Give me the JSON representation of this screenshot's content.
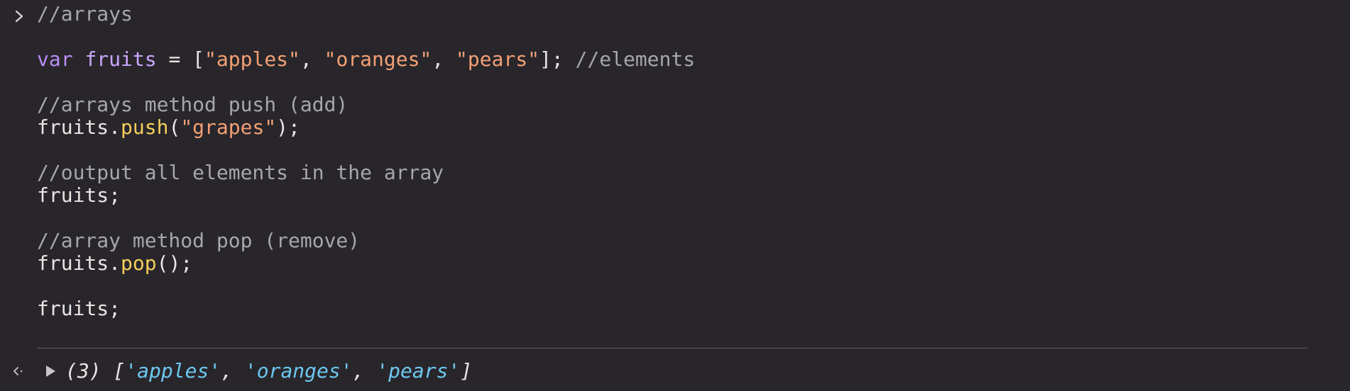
{
  "console": {
    "input": {
      "lines": [
        {
          "tokens": [
            {
              "t": "//arrays",
              "k": "comment"
            }
          ]
        },
        {
          "tokens": []
        },
        {
          "tokens": [
            {
              "t": "var",
              "k": "keyword"
            },
            {
              "t": " ",
              "k": "plain"
            },
            {
              "t": "fruits",
              "k": "var"
            },
            {
              "t": " = [",
              "k": "plain"
            },
            {
              "t": "\"apples\"",
              "k": "string"
            },
            {
              "t": ", ",
              "k": "plain"
            },
            {
              "t": "\"oranges\"",
              "k": "string"
            },
            {
              "t": ", ",
              "k": "plain"
            },
            {
              "t": "\"pears\"",
              "k": "string"
            },
            {
              "t": "]; ",
              "k": "plain"
            },
            {
              "t": "//elements",
              "k": "comment"
            }
          ]
        },
        {
          "tokens": []
        },
        {
          "tokens": [
            {
              "t": "//arrays method push (add)",
              "k": "comment"
            }
          ]
        },
        {
          "tokens": [
            {
              "t": "fruits.",
              "k": "plain"
            },
            {
              "t": "push",
              "k": "method"
            },
            {
              "t": "(",
              "k": "plain"
            },
            {
              "t": "\"grapes\"",
              "k": "string"
            },
            {
              "t": ");",
              "k": "plain"
            }
          ]
        },
        {
          "tokens": []
        },
        {
          "tokens": [
            {
              "t": "//output all elements in the array",
              "k": "comment"
            }
          ]
        },
        {
          "tokens": [
            {
              "t": "fruits;",
              "k": "plain"
            }
          ]
        },
        {
          "tokens": []
        },
        {
          "tokens": [
            {
              "t": "//array method pop (remove)",
              "k": "comment"
            }
          ]
        },
        {
          "tokens": [
            {
              "t": "fruits.",
              "k": "plain"
            },
            {
              "t": "pop",
              "k": "method"
            },
            {
              "t": "();",
              "k": "plain"
            }
          ]
        },
        {
          "tokens": []
        },
        {
          "tokens": [
            {
              "t": "fruits;",
              "k": "plain"
            }
          ]
        }
      ]
    },
    "output": {
      "count": "(3)",
      "open_bracket": " [",
      "items": [
        "'apples'",
        "'oranges'",
        "'pears'"
      ],
      "separator": ", ",
      "close_bracket": "]"
    },
    "icons": {
      "prompt": "chevron-right-icon",
      "return": "return-arrow-icon",
      "expand": "triangle-right-icon"
    },
    "colors": {
      "background": "#28262b",
      "comment": "#a8a6ad",
      "keyword": "#b88cf3",
      "string": "#f3a074",
      "method": "#f4cf5b",
      "result_string": "#6cc8f0"
    }
  }
}
